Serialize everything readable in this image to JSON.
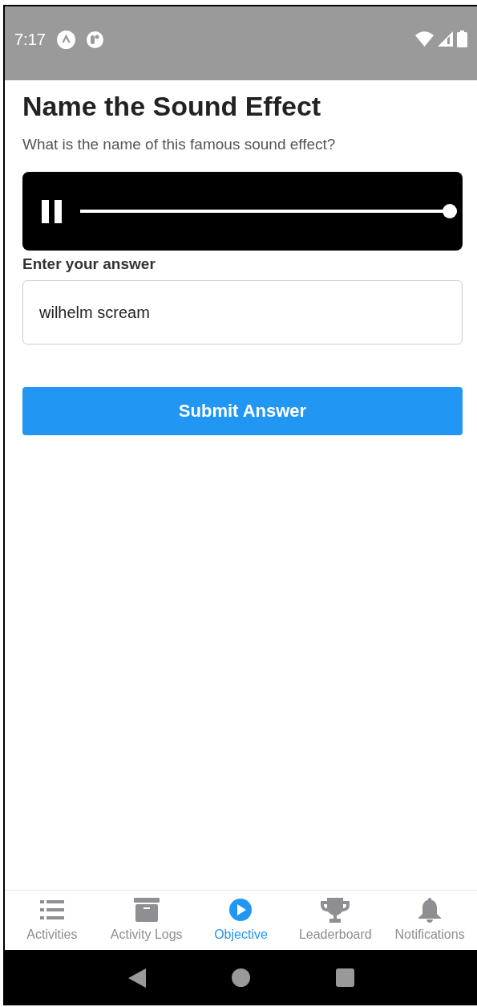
{
  "status_bar": {
    "time": "7:17"
  },
  "page": {
    "title": "Name the Sound Effect",
    "question": "What is the name of this famous sound effect?"
  },
  "player": {
    "playing": true,
    "level": 1.0
  },
  "answer": {
    "label": "Enter your answer",
    "value": "wilhelm scream"
  },
  "submit_button": "Submit Answer",
  "tabs": [
    {
      "kind": "list",
      "label": "Activities",
      "selected": false
    },
    {
      "kind": "archive",
      "label": "Activity Logs",
      "selected": false
    },
    {
      "kind": "play",
      "label": "Objective",
      "selected": true
    },
    {
      "kind": "trophy",
      "label": "Leaderboard",
      "selected": false
    },
    {
      "kind": "bell",
      "label": "Notifications",
      "selected": false
    }
  ]
}
